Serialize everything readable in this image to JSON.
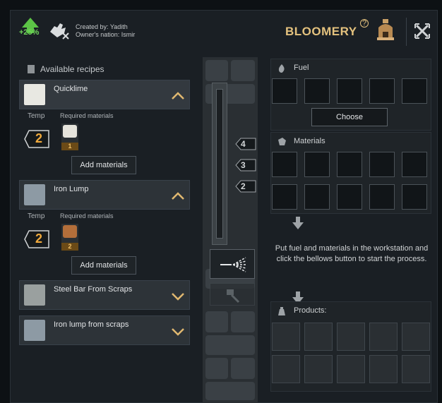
{
  "header": {
    "bonus": "+25%",
    "created_by": "Created by: Yadith",
    "owner_nation": "Owner's nation: Ismir",
    "title": "BLOOMERY",
    "help": "?"
  },
  "recipes": {
    "section_label": "Available recipes",
    "temp_label": "Temp",
    "req_label": "Required materials",
    "items": [
      {
        "name": "Quicklime",
        "temp": "2",
        "material_count": "1",
        "button": "Add materials"
      },
      {
        "name": "Iron Lump",
        "temp": "2",
        "material_count": "2",
        "button": "Add materials"
      },
      {
        "name": "Steel Bar From Scraps"
      },
      {
        "name": "Iron lump from scraps"
      }
    ]
  },
  "temperature_levels": [
    "4",
    "3",
    "2"
  ],
  "fuel": {
    "label": "Fuel",
    "choose": "Choose"
  },
  "materials": {
    "label": "Materials"
  },
  "instructions": "Put fuel and materials in the workstation and click the bellows button to start the process.",
  "products": {
    "label": "Products:"
  },
  "colors": {
    "accent_gold": "#e4c27e",
    "bonus_green": "#6fd45a",
    "temp_orange": "#f0a93c"
  }
}
